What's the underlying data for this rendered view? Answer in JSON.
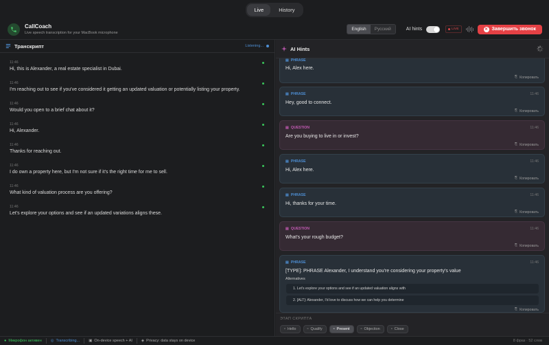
{
  "nav": {
    "tabs": [
      "Live",
      "History"
    ],
    "active": "Live"
  },
  "header": {
    "app_name": "CallCoach",
    "subtitle": "Live speech transcription for your MacBook microphone",
    "languages": [
      "English",
      "Русский"
    ],
    "ai_hints_label": "AI hints",
    "live_badge": "LIVE",
    "end_call_label": "Завершить звонок"
  },
  "transcript": {
    "title": "Транскрипт",
    "status": "Listening...",
    "messages": [
      {
        "time": "11:46",
        "text": "Hi, this is Alexander, a real estate specialist in Dubai."
      },
      {
        "time": "11:46",
        "text": "I'm reaching out to see if you've considered it getting an updated valuation or potentially listing your property."
      },
      {
        "time": "11:46",
        "text": "Would you open to a brief chat about it?"
      },
      {
        "time": "11:46",
        "text": "Hi, Alexander."
      },
      {
        "time": "11:46",
        "text": "Thanks for reaching out."
      },
      {
        "time": "11:46",
        "text": "I do own a property here, but I'm not sure if it's the right time for me to sell."
      },
      {
        "time": "11:46",
        "text": "What kind of valuation process are you offering?"
      },
      {
        "time": "11:46",
        "text": "Let's explore your options and see if an updated variations aligns these."
      }
    ]
  },
  "hints": {
    "title": "AI Hints",
    "copy_label": "Копировать",
    "alternatives_label": "Alternatives",
    "cards": [
      {
        "type": "PHRASE",
        "time": "",
        "text": "Hi, Alex here."
      },
      {
        "type": "PHRASE",
        "time": "11:46",
        "text": "Hey, good to connect."
      },
      {
        "type": "QUESTION",
        "time": "11:46",
        "text": "Are you buying to live in or invest?"
      },
      {
        "type": "PHRASE",
        "time": "11:46",
        "text": "Hi, Alex here."
      },
      {
        "type": "PHRASE",
        "time": "11:46",
        "text": "Hi, thanks for your time."
      },
      {
        "type": "QUESTION",
        "time": "11:46",
        "text": "What's your rough budget?"
      },
      {
        "type": "PHRASE",
        "time": "11:46",
        "text": "[TYPE]: PHRASE Alexander, I understand you're considering your property's value",
        "alternatives": [
          "1.   Let's explore your options and see if an updated valuation aligns with",
          "2.   [ALT]: Alexander, I'd love to discuss how we can help you determine"
        ]
      }
    ]
  },
  "stages": {
    "label": "ЭТАП СКРИПТА",
    "items": [
      "Hello",
      "Qualify",
      "Present",
      "Objection",
      "Close"
    ],
    "active": "Present"
  },
  "status_bar": {
    "mic": "Микрофон активен",
    "transcribing": "Transcribing...",
    "device": "On-device speech + AI",
    "privacy": "Privacy: data stays on device",
    "counts": "8 фраз · 52 слов"
  },
  "colors": {
    "accent": "#4e8fd4",
    "danger": "#e54145",
    "question": "#c25ab3",
    "ok": "#39c55a"
  }
}
